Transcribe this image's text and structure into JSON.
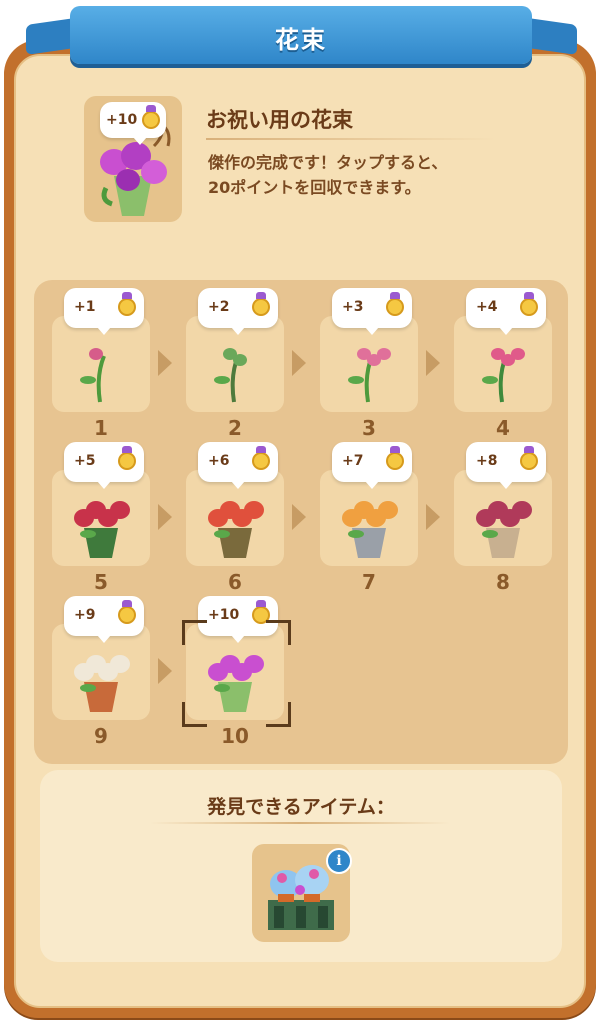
{
  "header": {
    "title": "花束"
  },
  "item": {
    "name": "お祝い用の花束",
    "description_line1": "傑作の完成です！タップすると、",
    "description_line2": "20ポイントを回収できます。",
    "badge": "+10",
    "icon": "celebration-bouquet-icon"
  },
  "chain": [
    {
      "level": "1",
      "points": "+1",
      "icon": "single-rose-stem-icon"
    },
    {
      "level": "2",
      "points": "+2",
      "icon": "crossed-stems-icon"
    },
    {
      "level": "3",
      "points": "+3",
      "icon": "pink-rose-icon"
    },
    {
      "level": "4",
      "points": "+4",
      "icon": "rose-pair-icon"
    },
    {
      "level": "5",
      "points": "+5",
      "icon": "red-bouquet-icon"
    },
    {
      "level": "6",
      "points": "+6",
      "icon": "rose-vase-icon"
    },
    {
      "level": "7",
      "points": "+7",
      "icon": "mixed-flower-vase-icon"
    },
    {
      "level": "8",
      "points": "+8",
      "icon": "tropical-flower-vase-icon"
    },
    {
      "level": "9",
      "points": "+9",
      "icon": "lily-pot-icon"
    },
    {
      "level": "10",
      "points": "+10",
      "icon": "celebration-bouquet-icon",
      "selected": true
    }
  ],
  "discover": {
    "title": "発見できるアイテム：",
    "icon": "flower-stand-icon",
    "info_icon": "i"
  },
  "colors": {
    "ribbon": "#2f86c9",
    "frame": "#c2702c",
    "panel": "#f6e0b6",
    "coin": "#f5c842",
    "crown": "#9b5ad0"
  }
}
